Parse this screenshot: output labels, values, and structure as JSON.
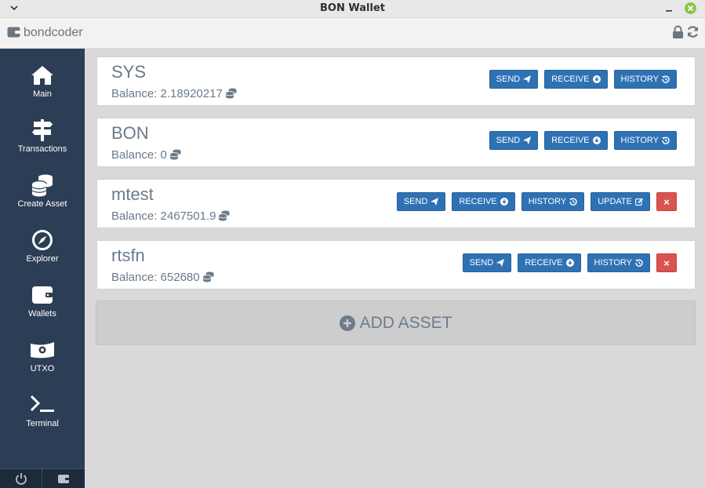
{
  "window": {
    "title": "BON Wallet"
  },
  "header": {
    "wallet_name": "bondcoder"
  },
  "sidebar": {
    "items": [
      {
        "label": "Main",
        "icon": "home-icon"
      },
      {
        "label": "Transactions",
        "icon": "signpost-icon"
      },
      {
        "label": "Create Asset",
        "icon": "coins-icon"
      },
      {
        "label": "Explorer",
        "icon": "compass-icon"
      },
      {
        "label": "Wallets",
        "icon": "wallet-icon"
      },
      {
        "label": "UTXO",
        "icon": "money-icon"
      },
      {
        "label": "Terminal",
        "icon": "terminal-icon"
      }
    ],
    "footer": [
      "power-icon",
      "wallet-icon"
    ]
  },
  "buttons": {
    "send": "SEND",
    "receive": "RECEIVE",
    "history": "HISTORY",
    "update": "UPDATE",
    "delete": "×"
  },
  "assets": [
    {
      "name": "SYS",
      "balance_label": "Balance:",
      "balance": "2.18920217"
    },
    {
      "name": "BON",
      "balance_label": "Balance:",
      "balance": "0"
    },
    {
      "name": "mtest",
      "balance_label": "Balance:",
      "balance": "2467501.9"
    },
    {
      "name": "rtsfn",
      "balance_label": "Balance:",
      "balance": "652680"
    }
  ],
  "add_asset": {
    "label": "ADD ASSET"
  },
  "colors": {
    "sidebar": "#2c3e55",
    "button": "#2f72b4",
    "danger": "#d9534f",
    "text": "#6b7a89"
  }
}
